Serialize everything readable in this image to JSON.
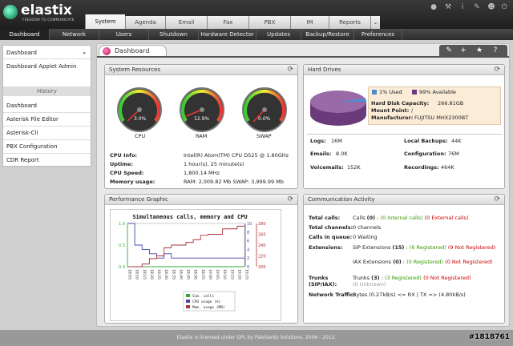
{
  "brand": {
    "name": "elastix",
    "tagline": "FREEDOM TO COMMUNICATE"
  },
  "top_links": [
    "droplet-icon",
    "wrench-icon",
    "info-icon",
    "edit-icon",
    "user-icon",
    "power-icon"
  ],
  "tabs": [
    "System",
    "Agenda",
    "Email",
    "Fax",
    "PBX",
    "IM",
    "Reports"
  ],
  "subnav": [
    "Dashboard",
    "Network",
    "Users",
    "Shutdown",
    "Hardware Detector",
    "Updates",
    "Backup/Restore",
    "Preferences"
  ],
  "sidebar": {
    "items": [
      "Dashboard",
      "Dashboard Applet Admin"
    ],
    "history_label": "History",
    "history": [
      "Dashboard",
      "Asterisk File Editor",
      "Asterisk-Cli",
      "PBX Configuration",
      "CDR Report"
    ]
  },
  "page": {
    "title": "Dashboard"
  },
  "system_resources": {
    "title": "System Resources",
    "gauges": [
      {
        "label": "CPU",
        "value": "3.0%"
      },
      {
        "label": "RAM",
        "value": "12.9%"
      },
      {
        "label": "SWAP",
        "value": "0.0%"
      }
    ],
    "rows": [
      {
        "k": "CPU Info:",
        "v": "Intel(R) Atom(TM) CPU D525 @ 1.80GHz"
      },
      {
        "k": "Uptime:",
        "v": "1 hour(s), 25 minute(s)"
      },
      {
        "k": "CPU Speed:",
        "v": "1,800.14 MHz"
      },
      {
        "k": "Memory usage:",
        "v": "RAM: 2,009.82 Mb SWAP: 3,999.99 Mb"
      }
    ]
  },
  "hard_drives": {
    "title": "Hard Drives",
    "used": "1% Used",
    "available": "99% Available",
    "rows": [
      {
        "k": "Hard Disk Capacity:",
        "v": "266.81GB"
      },
      {
        "k": "Mount Point:",
        "v": "/"
      },
      {
        "k": "Manufacturer:",
        "v": "FUJITSU MHX2300BT"
      }
    ],
    "stats": [
      {
        "k": "Logs:",
        "v": "16M"
      },
      {
        "k": "Local Backups:",
        "v": "44K"
      },
      {
        "k": "Emails:",
        "v": "8.0K"
      },
      {
        "k": "Configuration:",
        "v": "76M"
      },
      {
        "k": "Voicemails:",
        "v": "152K"
      },
      {
        "k": "Recordings:",
        "v": "464K"
      }
    ]
  },
  "performance": {
    "title": "Performance Graphic"
  },
  "chart_data": {
    "type": "line",
    "title": "Simultaneous calls, memory and CPU",
    "x": [
      "18:05",
      "18:10",
      "18:15",
      "18:20",
      "18:25",
      "18:30",
      "18:35",
      "18:40",
      "18:45",
      "18:50",
      "18:55",
      "19:00",
      "19:05",
      "19:10",
      "19:15",
      "19:20",
      "19:25"
    ],
    "series": [
      {
        "name": "Sim. calls",
        "axis": "left",
        "values": [
          0,
          0,
          0,
          0,
          0,
          0,
          0,
          0,
          0,
          0,
          0,
          0,
          0,
          0,
          0,
          0,
          0
        ]
      },
      {
        "name": "CPU usage (%)",
        "axis": "right1",
        "values": [
          10,
          5,
          4,
          3,
          2,
          3,
          2,
          2,
          2,
          2,
          2,
          2,
          2,
          2,
          2,
          2,
          2
        ]
      },
      {
        "name": "Mem. usage (MB)",
        "axis": "right2",
        "values": [
          200,
          200,
          205,
          215,
          220,
          235,
          240,
          240,
          245,
          250,
          258,
          260,
          260,
          270,
          270,
          275,
          275
        ]
      }
    ],
    "ylim_left": [
      0,
      1
    ],
    "yticks_left": [
      "0.0",
      "0.5",
      "1.0"
    ],
    "ylim_right1": [
      0,
      10
    ],
    "yticks_right1": [
      "0",
      "2",
      "4",
      "6",
      "8",
      "10"
    ],
    "ylim_right2": [
      200,
      280
    ],
    "yticks_right2": [
      "200",
      "220",
      "240",
      "260",
      "280"
    ],
    "colors": {
      "left": "#33aa33",
      "right1": "#4444aa",
      "right2": "#aa3333"
    },
    "legend": "bottom"
  },
  "communication": {
    "title": "Communication Activity",
    "total_calls": {
      "k": "Total calls:",
      "count": "(0)",
      "internal": "(0 Internal calls)",
      "external": "(0 External calls)",
      "prefix": "Calls"
    },
    "total_channels": {
      "k": "Total channels:",
      "v": "0 channels"
    },
    "queue": {
      "k": "Calls in queue:",
      "v": "0 Waiting"
    },
    "extensions": {
      "k": "Extensions:",
      "sip_label": "SIP Extensions",
      "sip_count": "(15)",
      "sip_reg": "(6 Registered)",
      "sip_notreg": "(9 Not Registered)",
      "iax_label": "IAX Extensions",
      "iax_count": "(0)",
      "iax_reg": "(0 Registered)",
      "iax_notreg": "(0 Not Registered)"
    },
    "trunks": {
      "k": "Trunks (SIP/IAX):",
      "label": "Trunks",
      "count": "(3)",
      "reg": "(3 Registered)",
      "notreg": "(0 Not Registered)",
      "unknown": "(0 Unknown)"
    },
    "traffic": {
      "k": "Network Traffic:",
      "v": "Bytes (0.27kB/s) <= RX | TX => (4.80kB/s)"
    }
  },
  "footer": {
    "text": "Elastix is licensed under GPL by PaloSanto Solutions. 2006 - 2012."
  },
  "watermark": "#1818761"
}
